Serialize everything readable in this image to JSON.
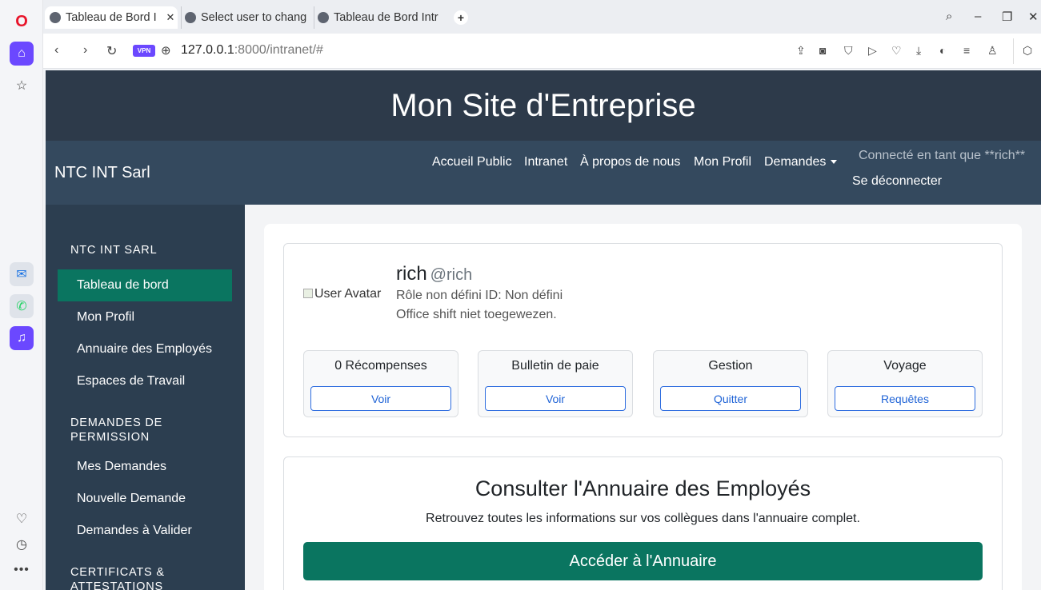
{
  "browser": {
    "tabs": [
      {
        "label": "Tableau de Bord I"
      },
      {
        "label": "Select user to chang"
      },
      {
        "label": "Tableau de Bord Intr"
      }
    ],
    "url_host": "127.0.0.1",
    "url_rest": ":8000/intranet/#",
    "vpn_label": "VPN"
  },
  "site": {
    "title": "Mon Site d'Entreprise",
    "brand": "NTC INT Sarl",
    "nav": {
      "home": "Accueil Public",
      "intranet": "Intranet",
      "about": "À propos de nous",
      "profile": "Mon Profil",
      "requests": "Demandes",
      "connected_as": "Connecté en tant que **rich**",
      "logout": "Se déconnecter"
    }
  },
  "sidebar": {
    "sections": [
      {
        "title": "NTC INT SARL",
        "items": [
          "Tableau de bord",
          "Mon Profil",
          "Annuaire des Employés",
          "Espaces de Travail"
        ]
      },
      {
        "title": "DEMANDES DE PERMISSION",
        "items": [
          "Mes Demandes",
          "Nouvelle Demande",
          "Demandes à Valider"
        ]
      },
      {
        "title": "CERTIFICATS & ATTESTATIONS",
        "items": []
      }
    ],
    "active": "Tableau de bord"
  },
  "profile": {
    "avatar_alt": "User Avatar",
    "name": "rich",
    "handle": "@rich",
    "role_line": "Rôle non défini ID: Non défini",
    "shift_line": "Office shift niet toegewezen."
  },
  "widgets": [
    {
      "title": "0 Récompenses",
      "button": "Voir"
    },
    {
      "title": "Bulletin de paie",
      "button": "Voir"
    },
    {
      "title": "Gestion",
      "button": "Quitter"
    },
    {
      "title": "Voyage",
      "button": "Requêtes"
    }
  ],
  "directory": {
    "title": "Consulter l'Annuaire des Employés",
    "subtitle": "Retrouvez toutes les informations sur vos collègues dans l'annuaire complet.",
    "button": "Accéder à l'Annuaire"
  },
  "colors": {
    "header_dark": "#2d3a4a",
    "nav_bg": "#34495e",
    "sidebar_bg": "#2c3e50",
    "accent_green": "#0a7560",
    "link_blue": "#1f63d6"
  }
}
